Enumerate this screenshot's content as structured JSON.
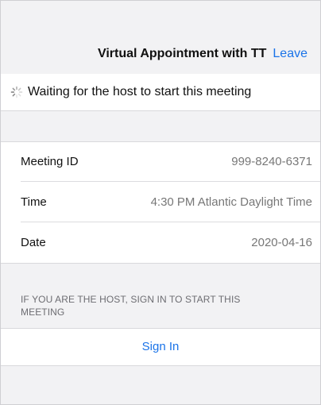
{
  "header": {
    "title": "Virtual Appointment with TT",
    "leave_label": "Leave"
  },
  "status": {
    "waiting_text": "Waiting for the host to start this meeting"
  },
  "details": [
    {
      "label": "Meeting ID",
      "value": "999-8240-6371"
    },
    {
      "label": "Time",
      "value": "4:30 PM Atlantic Daylight Time"
    },
    {
      "label": "Date",
      "value": "2020-04-16"
    }
  ],
  "host_note": "IF YOU ARE THE HOST, SIGN IN TO START THIS MEETING",
  "sign_in_label": "Sign In",
  "colors": {
    "accent": "#1a73e8",
    "background": "#f2f2f4",
    "muted_text": "#777777"
  }
}
